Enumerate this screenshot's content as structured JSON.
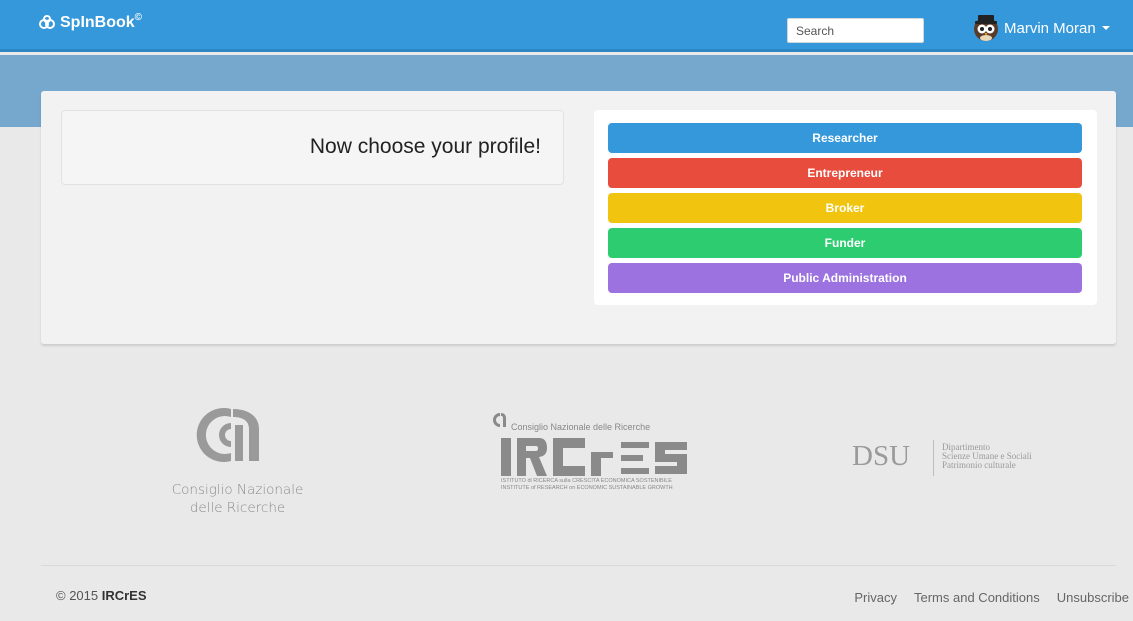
{
  "navbar": {
    "brand": "SpInBook",
    "brand_mark": "©",
    "search_placeholder": "Search",
    "user_name": "Marvin Moran"
  },
  "main": {
    "heading": "Now choose your profile!",
    "roles": [
      {
        "label": "Researcher",
        "color": "#3498db"
      },
      {
        "label": "Entrepreneur",
        "color": "#e74c3c"
      },
      {
        "label": "Broker",
        "color": "#f1c40f"
      },
      {
        "label": "Funder",
        "color": "#2ecc71"
      },
      {
        "label": "Public Administration",
        "color": "#9b72e0"
      }
    ]
  },
  "logos": {
    "cnr": {
      "line1": "Consiglio Nazionale",
      "line2": "delle Ricerche"
    },
    "ircres": {
      "top": "Consiglio Nazionale delle Ricerche",
      "sub1": "ISTITUTO di RICERCA sulla CRESCITA ECONOMICA SOSTENIBILE",
      "sub2": "INSTITUTE of RESEARCH on ECONOMIC SUSTAINABLE GROWTH"
    },
    "dsu": {
      "main": "DSU",
      "line1": "Dipartimento",
      "line2": "Scienze Umane e Sociali",
      "line3": "Patrimonio culturale"
    }
  },
  "footer": {
    "copyright_prefix": "© 2015 ",
    "copyright_org": "IRCrES",
    "links": [
      "Privacy",
      "Terms and Conditions",
      "Unsubscribe"
    ]
  }
}
